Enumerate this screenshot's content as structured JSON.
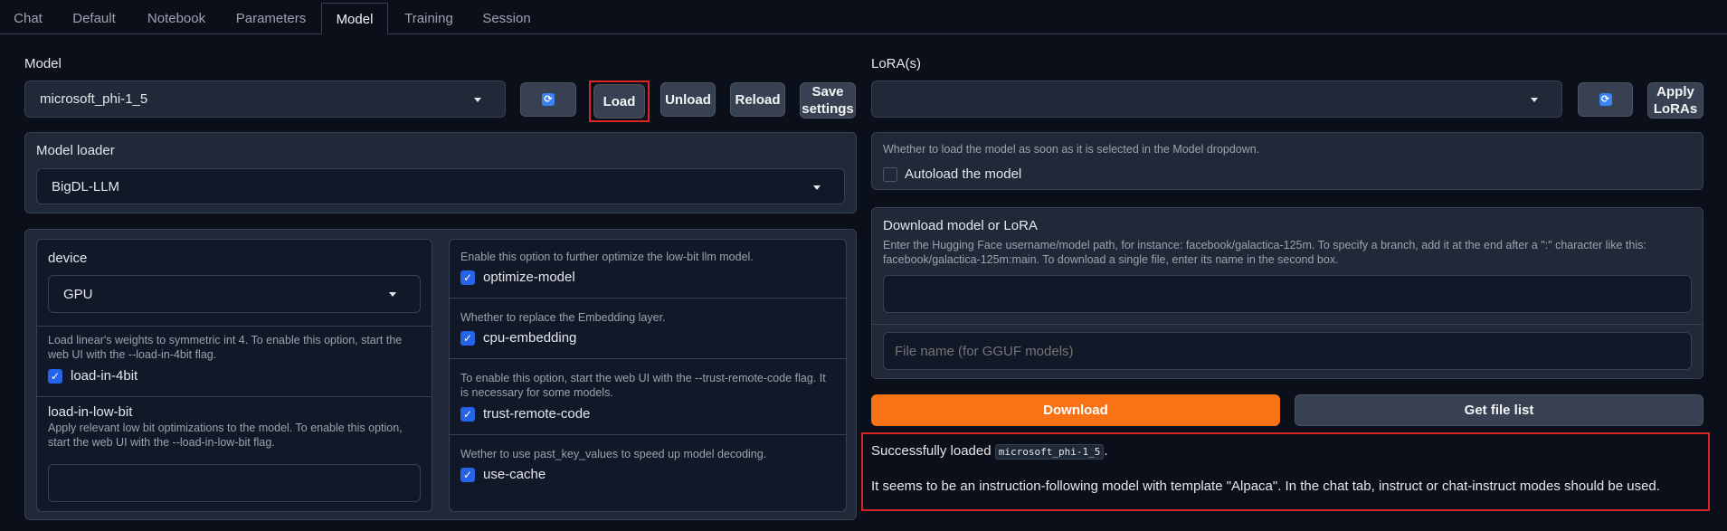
{
  "tabs": [
    "Chat",
    "Default",
    "Notebook",
    "Parameters",
    "Model",
    "Training",
    "Session"
  ],
  "active_tab": "Model",
  "model": {
    "label": "Model",
    "selected": "microsoft_phi-1_5",
    "refresh_icon": "refresh-icon",
    "load_label": "Load",
    "unload_label": "Unload",
    "reload_label": "Reload",
    "save_label_1": "Save",
    "save_label_2": "settings"
  },
  "loader": {
    "label": "Model loader",
    "selected": "BigDL-LLM"
  },
  "options_left": {
    "device_label": "device",
    "device_selected": "GPU",
    "load4bit_info": "Load linear's weights to symmetric int 4. To enable this option, start the web UI with the --load-in-4bit flag.",
    "load4bit_label": "load-in-4bit",
    "lowbit_label": "load-in-low-bit",
    "lowbit_info": "Apply relevant low bit optimizations to the model. To enable this option, start the web UI with the --load-in-low-bit flag.",
    "lowbit_value": ""
  },
  "options_right": {
    "optimize_info": "Enable this option to further optimize the low-bit llm model.",
    "optimize_label": "optimize-model",
    "cpuemb_info": "Whether to replace the Embedding layer.",
    "cpuemb_label": "cpu-embedding",
    "trust_info": "To enable this option, start the web UI with the --trust-remote-code flag. It is necessary for some models.",
    "trust_label": "trust-remote-code",
    "cache_info": "Wether to use past_key_values to speed up model decoding.",
    "cache_label": "use-cache"
  },
  "lora": {
    "label": "LoRA(s)",
    "selected": "",
    "apply_label_1": "Apply",
    "apply_label_2": "LoRAs"
  },
  "autoload": {
    "info": "Whether to load the model as soon as it is selected in the Model dropdown.",
    "label": "Autoload the model"
  },
  "download": {
    "title": "Download model or LoRA",
    "info": "Enter the Hugging Face username/model path, for instance: facebook/galactica-125m. To specify a branch, add it at the end after a \":\" character like this: facebook/galactica-125m:main. To download a single file, enter its name in the second box.",
    "path_value": "",
    "filename_placeholder": "File name (for GGUF models)",
    "download_label": "Download",
    "filelist_label": "Get file list"
  },
  "status": {
    "prefix": "Successfully loaded",
    "model_code": "microsoft_phi-1_5",
    "suffix": ".",
    "message": "It seems to be an instruction-following model with template \"Alpaca\". In the chat tab, instruct or chat-instruct modes should be used."
  },
  "colors": {
    "accent": "#2563eb",
    "download_button": "#f97316",
    "highlight_box": "#dc2626"
  }
}
